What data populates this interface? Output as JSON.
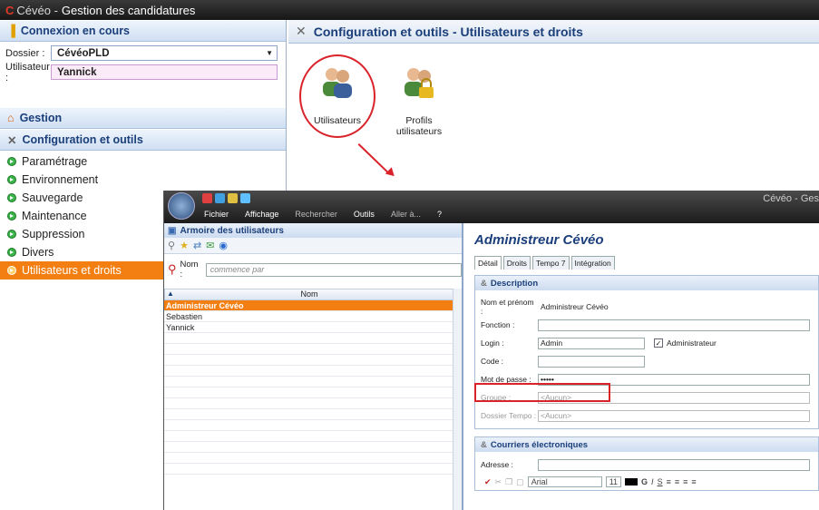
{
  "titlebar": {
    "logo": "C",
    "app": "Cévéo -",
    "title": "Gestion des candidatures"
  },
  "sidebar": {
    "connexion_title": "Connexion en cours",
    "dossier_label": "Dossier :",
    "dossier_value": "CévéoPLD",
    "utilisateur_label": "Utilisateur :",
    "utilisateur_value": "Yannick",
    "gestion_title": "Gestion",
    "config_title": "Configuration et outils",
    "items": [
      {
        "label": "Paramétrage"
      },
      {
        "label": "Environnement"
      },
      {
        "label": "Sauvegarde"
      },
      {
        "label": "Maintenance"
      },
      {
        "label": "Suppression"
      },
      {
        "label": "Divers"
      },
      {
        "label": "Utilisateurs et droits"
      }
    ]
  },
  "main": {
    "title": "Configuration et outils - Utilisateurs et droits",
    "icons": [
      {
        "label": "Utilisateurs"
      },
      {
        "label": "Profils utilisateurs"
      }
    ]
  },
  "app2": {
    "title": "Cévéo - Ges",
    "menu": [
      "Fichier",
      "Affichage",
      "Rechercher",
      "Outils",
      "Aller à...",
      "?"
    ],
    "left": {
      "title": "Armoire des utilisateurs",
      "search_label": "Nom :",
      "search_placeholder": "commence par",
      "column": "Nom",
      "rows": [
        "Administreur Cévéo",
        "Sebastien",
        "Yannick"
      ]
    },
    "right": {
      "title": "Administreur Cévéo",
      "tabs": [
        "Détail",
        "Droits",
        "Tempo 7",
        "Intégration"
      ],
      "desc_title": "Description",
      "nom_label": "Nom et prénom :",
      "nom_value": "Administreur Cévéo",
      "fonction_label": "Fonction :",
      "login_label": "Login :",
      "login_value": "Admin",
      "admin_label": "Administrateur",
      "code_label": "Code :",
      "mdp_label": "Mot de passe :",
      "mdp_value": "•••••",
      "groupe_label": "Groupe :",
      "groupe_value": "<Aucun>",
      "dossier_label": "Dossier Tempo :",
      "dossier_value": "<Aucun>",
      "mail_title": "Courriers électroniques",
      "adresse_label": "Adresse :",
      "font": "Arial",
      "size": "11"
    }
  }
}
